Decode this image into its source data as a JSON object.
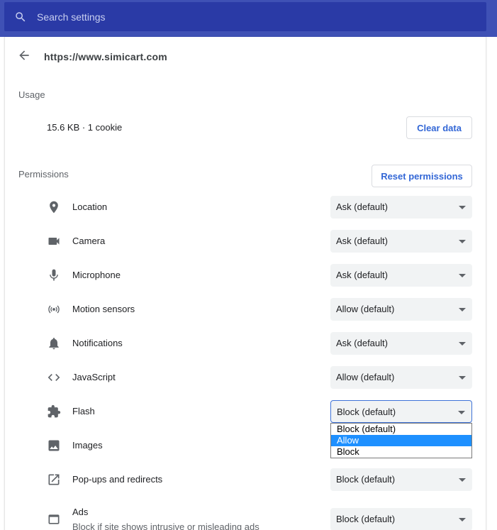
{
  "search": {
    "placeholder": "Search settings"
  },
  "site": {
    "url": "https://www.simicart.com"
  },
  "usage": {
    "label": "Usage",
    "summary": "15.6 KB · 1 cookie",
    "clear_button": "Clear data"
  },
  "permissions": {
    "label": "Permissions",
    "reset_button": "Reset permissions",
    "items": [
      {
        "icon": "location-pin-icon",
        "label": "Location",
        "value": "Ask (default)"
      },
      {
        "icon": "camera-icon",
        "label": "Camera",
        "value": "Ask (default)"
      },
      {
        "icon": "microphone-icon",
        "label": "Microphone",
        "value": "Ask (default)"
      },
      {
        "icon": "motion-sensors-icon",
        "label": "Motion sensors",
        "value": "Allow (default)"
      },
      {
        "icon": "bell-icon",
        "label": "Notifications",
        "value": "Ask (default)"
      },
      {
        "icon": "code-icon",
        "label": "JavaScript",
        "value": "Allow (default)"
      },
      {
        "icon": "puzzle-icon",
        "label": "Flash",
        "value": "Block (default)"
      },
      {
        "icon": "image-icon",
        "label": "Images",
        "value": ""
      },
      {
        "icon": "external-link-icon",
        "label": "Pop-ups and redirects",
        "value": "Block (default)"
      },
      {
        "icon": "window-icon",
        "label": "Ads",
        "sublabel": "Block if site shows intrusive or misleading ads",
        "value": "Block (default)"
      }
    ]
  },
  "flash_dropdown": {
    "options": [
      "Block (default)",
      "Allow",
      "Block"
    ],
    "highlighted": "Allow"
  },
  "colors": {
    "header": "#3f51b5",
    "search_bg": "#2a3aa6",
    "accent": "#3367d6",
    "select_bg": "#f1f3f4",
    "highlight": "#1e90ff"
  }
}
